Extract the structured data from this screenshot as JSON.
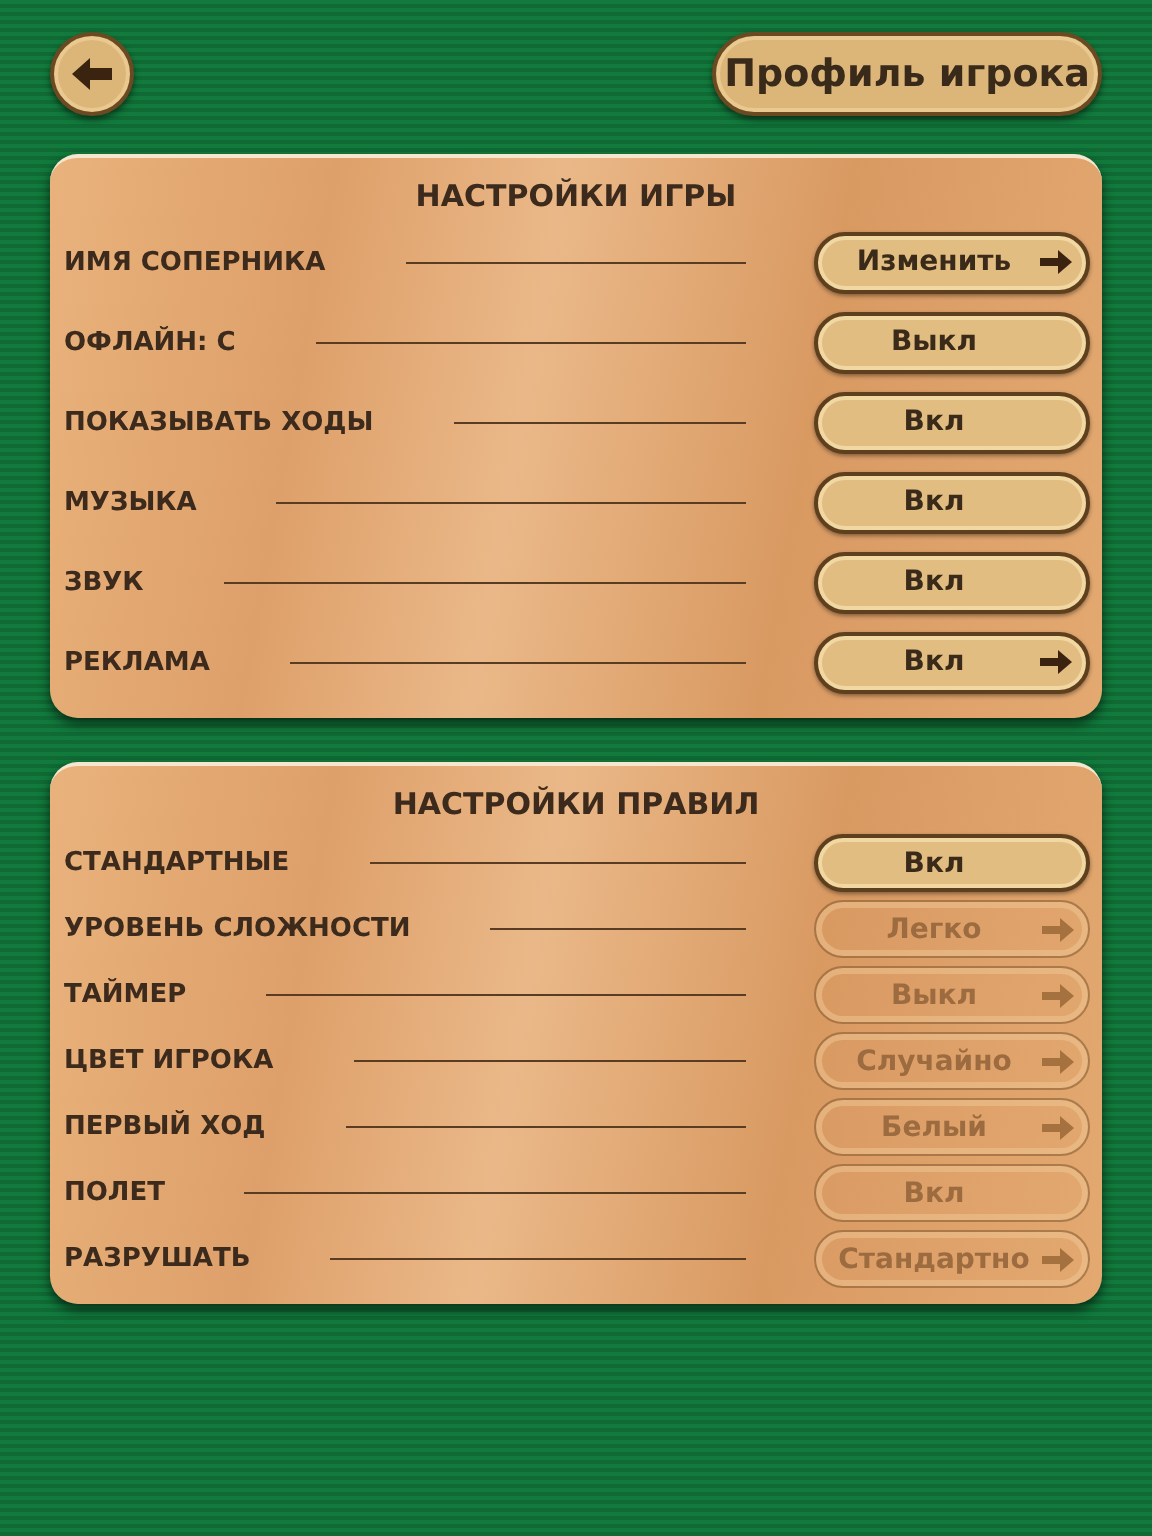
{
  "header": {
    "profile_button": "Профиль игрока"
  },
  "panels": [
    {
      "title": "НАСТРОЙКИ ИГРЫ",
      "rows": [
        {
          "label": "ИМЯ СОПЕРНИКА",
          "value": "Изменить",
          "arrow": true,
          "disabled": false
        },
        {
          "label": "ОФЛАЙН: С",
          "value": "Выкл",
          "arrow": false,
          "disabled": false
        },
        {
          "label": "ПОКАЗЫВАТЬ ХОДЫ",
          "value": "Вкл",
          "arrow": false,
          "disabled": false
        },
        {
          "label": "МУЗЫКА",
          "value": "Вкл",
          "arrow": false,
          "disabled": false
        },
        {
          "label": "ЗВУК",
          "value": "Вкл",
          "arrow": false,
          "disabled": false
        },
        {
          "label": "РЕКЛАМА",
          "value": "Вкл",
          "arrow": true,
          "disabled": false
        }
      ]
    },
    {
      "title": "НАСТРОЙКИ ПРАВИЛ",
      "rows": [
        {
          "label": "СТАНДАРТНЫЕ",
          "value": "Вкл",
          "arrow": false,
          "disabled": false
        },
        {
          "label": "УРОВЕНЬ СЛОЖНОСТИ",
          "value": "Легко",
          "arrow": true,
          "disabled": true
        },
        {
          "label": "ТАЙМЕР",
          "value": "Выкл",
          "arrow": true,
          "disabled": true
        },
        {
          "label": "ЦВЕТ ИГРОКА",
          "value": "Случайно",
          "arrow": true,
          "disabled": true
        },
        {
          "label": "ПЕРВЫЙ ХОД",
          "value": "Белый",
          "arrow": true,
          "disabled": true
        },
        {
          "label": "ПОЛЕТ",
          "value": "Вкл",
          "arrow": false,
          "disabled": true
        },
        {
          "label": "РАЗРУШАТЬ",
          "value": "Стандартно",
          "arrow": true,
          "disabled": true
        }
      ]
    }
  ]
}
